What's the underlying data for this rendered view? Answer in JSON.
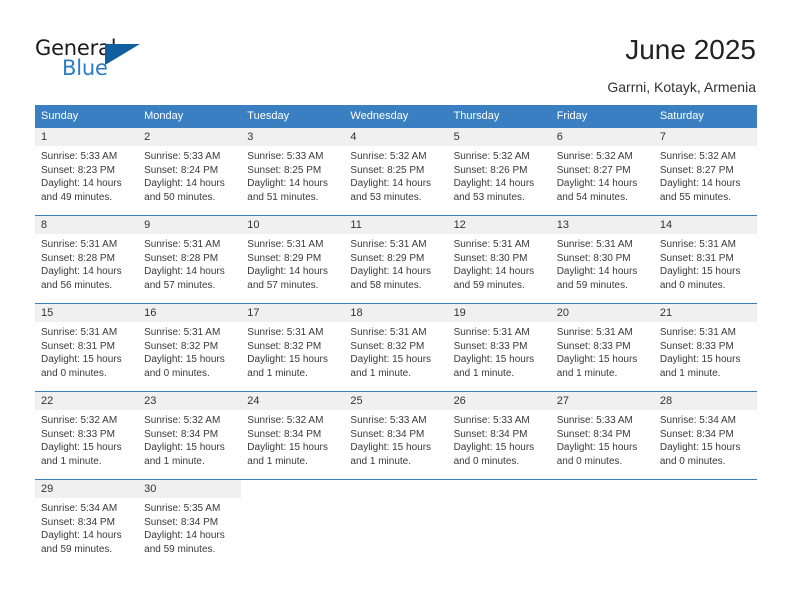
{
  "brand": {
    "word_one": "General",
    "word_two": "Blue",
    "triangle_icon": "triangle-icon",
    "color_dark": "#1b1b1b",
    "color_blue": "#2b7cc4",
    "color_triangle": "#115e9e"
  },
  "header": {
    "title": "June 2025",
    "subtitle": "Garrni, Kotayk, Armenia"
  },
  "theme": {
    "header_bg": "#3a7fc1",
    "header_text": "#ffffff",
    "daynum_bg": "#f0f0f0",
    "row_border": "#3a7fc1",
    "body_text": "#3a3a3a"
  },
  "calendar": {
    "weekday_headers": [
      "Sunday",
      "Monday",
      "Tuesday",
      "Wednesday",
      "Thursday",
      "Friday",
      "Saturday"
    ],
    "weeks": [
      [
        {
          "day": "1",
          "lines": [
            "Sunrise: 5:33 AM",
            "Sunset: 8:23 PM",
            "Daylight: 14 hours",
            "and 49 minutes."
          ]
        },
        {
          "day": "2",
          "lines": [
            "Sunrise: 5:33 AM",
            "Sunset: 8:24 PM",
            "Daylight: 14 hours",
            "and 50 minutes."
          ]
        },
        {
          "day": "3",
          "lines": [
            "Sunrise: 5:33 AM",
            "Sunset: 8:25 PM",
            "Daylight: 14 hours",
            "and 51 minutes."
          ]
        },
        {
          "day": "4",
          "lines": [
            "Sunrise: 5:32 AM",
            "Sunset: 8:25 PM",
            "Daylight: 14 hours",
            "and 53 minutes."
          ]
        },
        {
          "day": "5",
          "lines": [
            "Sunrise: 5:32 AM",
            "Sunset: 8:26 PM",
            "Daylight: 14 hours",
            "and 53 minutes."
          ]
        },
        {
          "day": "6",
          "lines": [
            "Sunrise: 5:32 AM",
            "Sunset: 8:27 PM",
            "Daylight: 14 hours",
            "and 54 minutes."
          ]
        },
        {
          "day": "7",
          "lines": [
            "Sunrise: 5:32 AM",
            "Sunset: 8:27 PM",
            "Daylight: 14 hours",
            "and 55 minutes."
          ]
        }
      ],
      [
        {
          "day": "8",
          "lines": [
            "Sunrise: 5:31 AM",
            "Sunset: 8:28 PM",
            "Daylight: 14 hours",
            "and 56 minutes."
          ]
        },
        {
          "day": "9",
          "lines": [
            "Sunrise: 5:31 AM",
            "Sunset: 8:28 PM",
            "Daylight: 14 hours",
            "and 57 minutes."
          ]
        },
        {
          "day": "10",
          "lines": [
            "Sunrise: 5:31 AM",
            "Sunset: 8:29 PM",
            "Daylight: 14 hours",
            "and 57 minutes."
          ]
        },
        {
          "day": "11",
          "lines": [
            "Sunrise: 5:31 AM",
            "Sunset: 8:29 PM",
            "Daylight: 14 hours",
            "and 58 minutes."
          ]
        },
        {
          "day": "12",
          "lines": [
            "Sunrise: 5:31 AM",
            "Sunset: 8:30 PM",
            "Daylight: 14 hours",
            "and 59 minutes."
          ]
        },
        {
          "day": "13",
          "lines": [
            "Sunrise: 5:31 AM",
            "Sunset: 8:30 PM",
            "Daylight: 14 hours",
            "and 59 minutes."
          ]
        },
        {
          "day": "14",
          "lines": [
            "Sunrise: 5:31 AM",
            "Sunset: 8:31 PM",
            "Daylight: 15 hours",
            "and 0 minutes."
          ]
        }
      ],
      [
        {
          "day": "15",
          "lines": [
            "Sunrise: 5:31 AM",
            "Sunset: 8:31 PM",
            "Daylight: 15 hours",
            "and 0 minutes."
          ]
        },
        {
          "day": "16",
          "lines": [
            "Sunrise: 5:31 AM",
            "Sunset: 8:32 PM",
            "Daylight: 15 hours",
            "and 0 minutes."
          ]
        },
        {
          "day": "17",
          "lines": [
            "Sunrise: 5:31 AM",
            "Sunset: 8:32 PM",
            "Daylight: 15 hours",
            "and 1 minute."
          ]
        },
        {
          "day": "18",
          "lines": [
            "Sunrise: 5:31 AM",
            "Sunset: 8:32 PM",
            "Daylight: 15 hours",
            "and 1 minute."
          ]
        },
        {
          "day": "19",
          "lines": [
            "Sunrise: 5:31 AM",
            "Sunset: 8:33 PM",
            "Daylight: 15 hours",
            "and 1 minute."
          ]
        },
        {
          "day": "20",
          "lines": [
            "Sunrise: 5:31 AM",
            "Sunset: 8:33 PM",
            "Daylight: 15 hours",
            "and 1 minute."
          ]
        },
        {
          "day": "21",
          "lines": [
            "Sunrise: 5:31 AM",
            "Sunset: 8:33 PM",
            "Daylight: 15 hours",
            "and 1 minute."
          ]
        }
      ],
      [
        {
          "day": "22",
          "lines": [
            "Sunrise: 5:32 AM",
            "Sunset: 8:33 PM",
            "Daylight: 15 hours",
            "and 1 minute."
          ]
        },
        {
          "day": "23",
          "lines": [
            "Sunrise: 5:32 AM",
            "Sunset: 8:34 PM",
            "Daylight: 15 hours",
            "and 1 minute."
          ]
        },
        {
          "day": "24",
          "lines": [
            "Sunrise: 5:32 AM",
            "Sunset: 8:34 PM",
            "Daylight: 15 hours",
            "and 1 minute."
          ]
        },
        {
          "day": "25",
          "lines": [
            "Sunrise: 5:33 AM",
            "Sunset: 8:34 PM",
            "Daylight: 15 hours",
            "and 1 minute."
          ]
        },
        {
          "day": "26",
          "lines": [
            "Sunrise: 5:33 AM",
            "Sunset: 8:34 PM",
            "Daylight: 15 hours",
            "and 0 minutes."
          ]
        },
        {
          "day": "27",
          "lines": [
            "Sunrise: 5:33 AM",
            "Sunset: 8:34 PM",
            "Daylight: 15 hours",
            "and 0 minutes."
          ]
        },
        {
          "day": "28",
          "lines": [
            "Sunrise: 5:34 AM",
            "Sunset: 8:34 PM",
            "Daylight: 15 hours",
            "and 0 minutes."
          ]
        }
      ],
      [
        {
          "day": "29",
          "lines": [
            "Sunrise: 5:34 AM",
            "Sunset: 8:34 PM",
            "Daylight: 14 hours",
            "and 59 minutes."
          ]
        },
        {
          "day": "30",
          "lines": [
            "Sunrise: 5:35 AM",
            "Sunset: 8:34 PM",
            "Daylight: 14 hours",
            "and 59 minutes."
          ]
        },
        {
          "day": "",
          "lines": []
        },
        {
          "day": "",
          "lines": []
        },
        {
          "day": "",
          "lines": []
        },
        {
          "day": "",
          "lines": []
        },
        {
          "day": "",
          "lines": []
        }
      ]
    ]
  }
}
